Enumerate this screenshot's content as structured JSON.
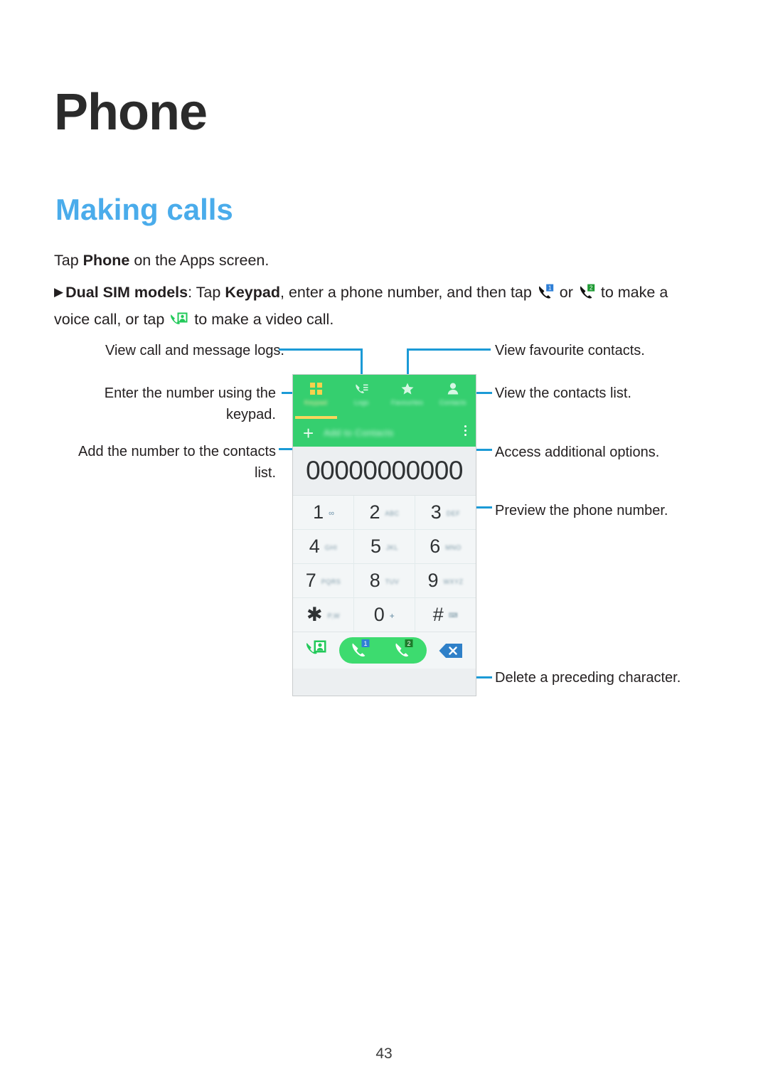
{
  "document": {
    "chapter_title": "Phone",
    "section_title": "Making calls",
    "page_number": "43"
  },
  "body": {
    "line1_prefix": "Tap ",
    "line1_bold": "Phone",
    "line1_suffix": " on the Apps screen.",
    "bullet_marker": "▶",
    "dual_sim_bold": "Dual SIM models",
    "dual_sim_colon": ": Tap ",
    "keypad_bold": "Keypad",
    "dual_sim_mid": ", enter a phone number, and then tap ",
    "dual_sim_or": " or ",
    "dual_sim_tail": " to make a voice call, or tap ",
    "dual_sim_end": " to make a video call.",
    "icon_sim1": "call-sim1-icon",
    "icon_sim2": "call-sim2-icon",
    "icon_video": "video-call-icon"
  },
  "callouts": {
    "view_logs": "View call and message logs.",
    "enter_number": "Enter the number using the keypad.",
    "add_contact": "Add the number to the contacts list.",
    "view_favourites": "View favourite contacts.",
    "view_contacts": "View the contacts list.",
    "additional_options": "Access additional options.",
    "preview_number": "Preview the phone number.",
    "delete_char": "Delete a preceding character."
  },
  "phone_ui": {
    "tabs": [
      {
        "label": "Keypad",
        "icon": "keypad-grid-icon",
        "active": true
      },
      {
        "label": "Logs",
        "icon": "call-log-icon",
        "active": false
      },
      {
        "label": "Favourites",
        "icon": "star-icon",
        "active": false
      },
      {
        "label": "Contacts",
        "icon": "person-icon",
        "active": false
      }
    ],
    "add_to_contacts": "Add to Contacts",
    "add_plus": "+",
    "overflow_menu": "more-options-icon",
    "dialed_number": "00000000000",
    "keys": [
      {
        "digit": "1",
        "sub": "∞",
        "sub_kind": "vm"
      },
      {
        "digit": "2",
        "sub": "ABC",
        "sub_kind": "letters"
      },
      {
        "digit": "3",
        "sub": "DEF",
        "sub_kind": "letters"
      },
      {
        "digit": "4",
        "sub": "GHI",
        "sub_kind": "letters"
      },
      {
        "digit": "5",
        "sub": "JKL",
        "sub_kind": "letters"
      },
      {
        "digit": "6",
        "sub": "MNO",
        "sub_kind": "letters"
      },
      {
        "digit": "7",
        "sub": "PQRS",
        "sub_kind": "letters"
      },
      {
        "digit": "8",
        "sub": "TUV",
        "sub_kind": "letters"
      },
      {
        "digit": "9",
        "sub": "WXYZ",
        "sub_kind": "letters"
      },
      {
        "digit": "✱",
        "sub": "P,W",
        "sub_kind": "letters"
      },
      {
        "digit": "0",
        "sub": "+",
        "sub_kind": "plus"
      },
      {
        "digit": "#",
        "sub": "⌨",
        "sub_kind": "sharp"
      }
    ],
    "actions": {
      "video_call": "video-call-icon",
      "call_sim1": "call-sim1-button",
      "call_sim2": "call-sim2-button",
      "backspace": "backspace-icon",
      "sim1_badge": "1",
      "sim2_badge": "2"
    }
  },
  "colors": {
    "accent_blue": "#4aaceb",
    "leader_line": "#1b9ad6",
    "phone_green": "#35cf6f",
    "call_pill_green": "#3ddb6f",
    "tab_underline": "#f9d65c",
    "backspace_blue": "#2f80c8"
  }
}
